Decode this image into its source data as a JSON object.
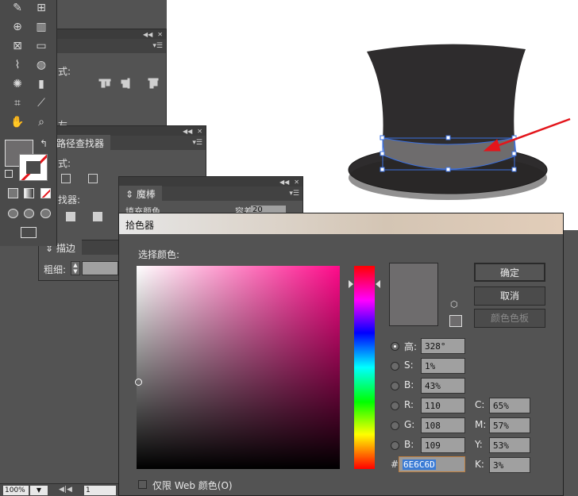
{
  "canvas": {
    "hat_color": "#2e2c2d",
    "band_color": "#6e6c6d",
    "selection_color": "#3a6fe0",
    "arrow_color": "#e3151b"
  },
  "tools_panel": {
    "tool_icons": [
      "pen-warp-icon",
      "mesh-icon",
      "shape-builder-icon",
      "graph-icon",
      "mesh-grid-icon",
      "gradient-icon",
      "eyedropper-icon",
      "blend-icon",
      "symbol-sprayer-icon",
      "column-graph-icon",
      "artboard-icon",
      "slice-icon",
      "hand-icon",
      "zoom-icon"
    ],
    "fill_color": "#6e6c6d"
  },
  "align_panel": {
    "label1": "式:",
    "label2": "左"
  },
  "pathfinder_panel": {
    "tab": "路径查找器",
    "label1": "式:",
    "label2": "找器:"
  },
  "magic_panel": {
    "tab": "魔棒",
    "row": "填充颜色",
    "tolerance_label": "容差",
    "tolerance_value": "20"
  },
  "stroke_panel": {
    "tab": "描边",
    "weight_label": "粗细:"
  },
  "status_bar": {
    "zoom": "100%",
    "page": "1"
  },
  "picker": {
    "title": "拾色器",
    "select_label": "选择颜色:",
    "current_color": "#6e6c6d",
    "hsb": {
      "h_label": "高:",
      "h": "328°",
      "s_label": "S:",
      "s": "1%",
      "b_label": "B:",
      "b": "43%"
    },
    "rgb": {
      "r_label": "R:",
      "r": "110",
      "g_label": "G:",
      "g": "108",
      "b_label": "B:",
      "b": "109"
    },
    "cmyk": {
      "c_label": "C:",
      "c": "65%",
      "m_label": "M:",
      "m": "57%",
      "y_label": "Y:",
      "y": "53%",
      "k_label": "K:",
      "k": "3%"
    },
    "hex_label": "#",
    "hex": "6E6C6D",
    "ok": "确定",
    "cancel": "取消",
    "swatches": "颜色色板",
    "web_only": "仅限 Web 颜色(O)",
    "hue_fraction": 0.09
  }
}
